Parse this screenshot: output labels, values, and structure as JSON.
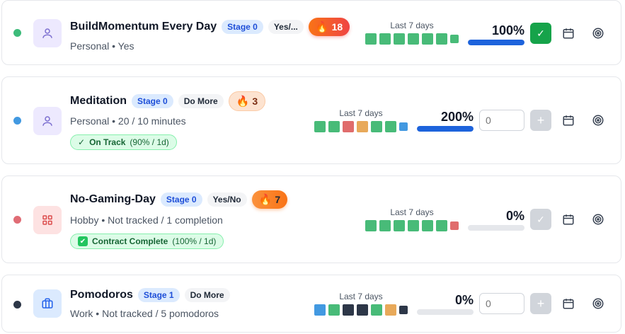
{
  "habits": [
    {
      "title": "BuildMomentum Every Day",
      "stage": "Stage 0",
      "mode": "Yes/...",
      "streak": "18",
      "streak_style": "hot",
      "subtitle": "Personal • Yes",
      "dot_color": "#3dbb7a",
      "category_icon": "person-icon",
      "status": null,
      "week_label": "Last 7 days",
      "week": [
        "green",
        "green",
        "green",
        "green",
        "green",
        "green",
        "green"
      ],
      "progress_text": "100%",
      "progress": 1.0,
      "action": "check",
      "action_state": "active",
      "input_value": null,
      "input_placeholder": null
    },
    {
      "title": "Meditation",
      "stage": "Stage 0",
      "mode": "Do More",
      "streak": "3",
      "streak_style": "warm",
      "subtitle": "Personal • 20 / 10 minutes",
      "dot_color": "#4299e1",
      "category_icon": "person-icon",
      "status": {
        "label": "On Track",
        "detail": "(90% / 1d)",
        "icon": "✓"
      },
      "week_label": "Last 7 days",
      "week": [
        "green",
        "green",
        "red",
        "orange",
        "green",
        "green",
        "blue"
      ],
      "progress_text": "200%",
      "progress": 1.0,
      "action": "input",
      "action_state": "inactive",
      "input_value": "",
      "input_placeholder": "0"
    },
    {
      "title": "No-Gaming-Day",
      "stage": "Stage 0",
      "mode": "Yes/No",
      "streak": "7",
      "streak_style": "mid",
      "subtitle": "Hobby • Not tracked / 1 completion",
      "dot_color": "#e06c75",
      "category_icon": "grid-icon",
      "status": {
        "label": "Contract Complete",
        "detail": "(100% / 1d)",
        "icon": "✔"
      },
      "week_label": "Last 7 days",
      "week": [
        "green",
        "green",
        "green",
        "green",
        "green",
        "green",
        "red"
      ],
      "progress_text": "0%",
      "progress": 0,
      "action": "check",
      "action_state": "inactive",
      "input_value": null,
      "input_placeholder": null
    },
    {
      "title": "Pomodoros",
      "stage": "Stage 1",
      "mode": "Do More",
      "streak": null,
      "streak_style": null,
      "subtitle": "Work • Not tracked / 5 pomodoros",
      "dot_color": "#2d3748",
      "category_icon": "briefcase-icon",
      "status": null,
      "week_label": "Last 7 days",
      "week": [
        "blue",
        "green",
        "dark",
        "dark",
        "green",
        "orange",
        "dark"
      ],
      "progress_text": "0%",
      "progress": 0,
      "action": "input",
      "action_state": "inactive",
      "input_value": "",
      "input_placeholder": "0"
    }
  ],
  "colors": {
    "green": "#48bb78",
    "red": "#e06c6c",
    "orange": "#e8a95a",
    "blue": "#4299e1",
    "dark": "#2d3748",
    "progress_fill": "#1d63dc",
    "done_active": "#16a34a"
  },
  "icons": {
    "calendar": "calendar-icon",
    "target": "target-icon",
    "flame": "🔥",
    "plus": "+",
    "check": "✓"
  }
}
